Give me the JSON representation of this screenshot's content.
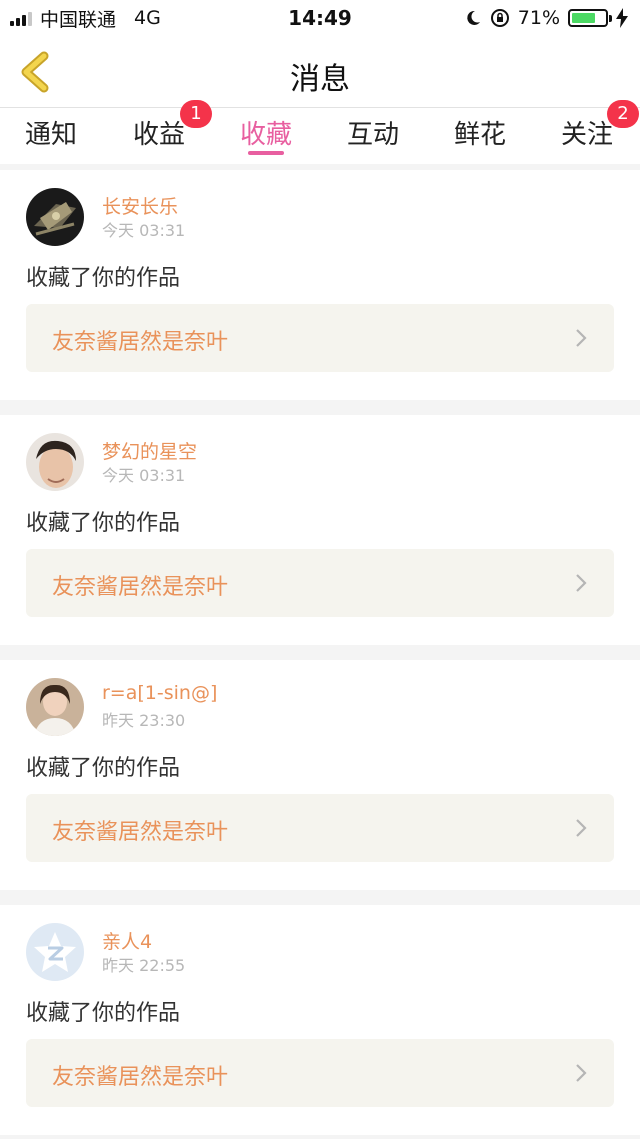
{
  "status_bar": {
    "carrier": "中国联通",
    "network": "4G",
    "time": "14:49",
    "battery_percent": "71%",
    "battery_level": 0.71,
    "battery_color": "#4cd964"
  },
  "nav": {
    "back_icon": "chevron-left-icon",
    "title": "消息"
  },
  "tabs": [
    {
      "label": "通知",
      "badge": null
    },
    {
      "label": "收益",
      "badge": "1"
    },
    {
      "label": "收藏",
      "badge": null,
      "active": true
    },
    {
      "label": "互动",
      "badge": null
    },
    {
      "label": "鲜花",
      "badge": null
    },
    {
      "label": "关注",
      "badge": "2"
    }
  ],
  "accent_color": "#e85fa0",
  "name_color": "#e9925a",
  "badge_color": "#f4334a",
  "messages": [
    {
      "user": "长安长乐",
      "time": "今天 03:31",
      "action": "收藏了你的作品",
      "work": "友奈酱居然是奈叶"
    },
    {
      "user": "梦幻的星空",
      "time": "今天 03:31",
      "action": "收藏了你的作品",
      "work": "友奈酱居然是奈叶"
    },
    {
      "user": "r=a[1-sin@]",
      "time": "昨天 23:30",
      "action": "收藏了你的作品",
      "work": "友奈酱居然是奈叶"
    },
    {
      "user": "亲人4",
      "time": "昨天 22:55",
      "action": "收藏了你的作品",
      "work": "友奈酱居然是奈叶"
    }
  ]
}
